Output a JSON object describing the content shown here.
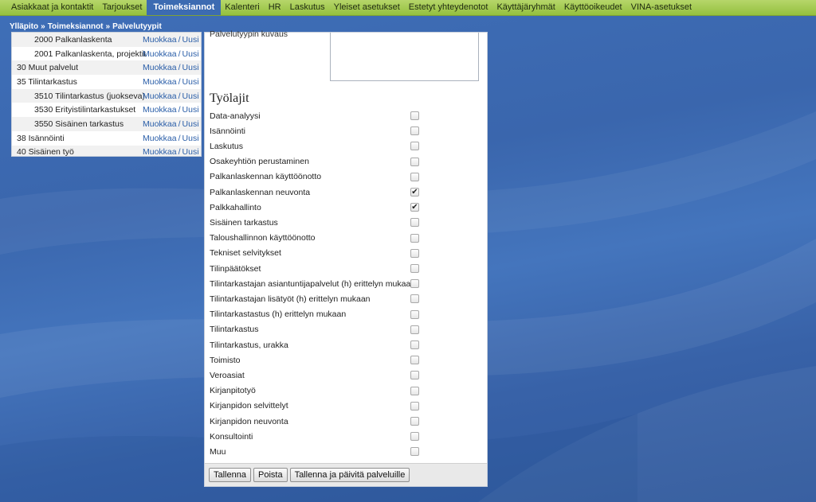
{
  "nav": {
    "items": [
      {
        "label": "Asiakkaat ja kontaktit",
        "active": false
      },
      {
        "label": "Tarjoukset",
        "active": false
      },
      {
        "label": "Toimeksiannot",
        "active": true
      },
      {
        "label": "Kalenteri",
        "active": false
      },
      {
        "label": "HR",
        "active": false
      },
      {
        "label": "Laskutus",
        "active": false
      },
      {
        "label": "Yleiset asetukset",
        "active": false
      },
      {
        "label": "Estetyt yhteydenotot",
        "active": false
      },
      {
        "label": "Käyttäjäryhmät",
        "active": false
      },
      {
        "label": "Käyttöoikeudet",
        "active": false
      },
      {
        "label": "VINA-asetukset",
        "active": false
      }
    ]
  },
  "breadcrumb": {
    "items": [
      "Ylläpito",
      "Toimeksiannot",
      "Palvelutyypit"
    ],
    "separator": "»"
  },
  "service_list": {
    "edit_label": "Muokkaa",
    "new_label": "Uusi",
    "separator": "/",
    "rows": [
      {
        "name": "2000 Palkanlaskenta",
        "level": 1
      },
      {
        "name": "2001 Palkanlaskenta, projektit",
        "level": 1
      },
      {
        "name": "30 Muut palvelut",
        "level": 0
      },
      {
        "name": "35 Tilintarkastus",
        "level": 0
      },
      {
        "name": "3510 Tilintarkastus (juokseva)",
        "level": 1
      },
      {
        "name": "3530 Erityistilintarkastukset",
        "level": 1
      },
      {
        "name": "3550 Sisäinen tarkastus",
        "level": 1
      },
      {
        "name": "38 Isännöinti",
        "level": 0
      },
      {
        "name": "40 Sisäinen työ",
        "level": 0
      }
    ]
  },
  "form": {
    "description_label": "Palvelutyypin kuvaus",
    "description_value": "",
    "worktypes_title": "Työlajit",
    "worktypes": [
      {
        "label": "Data-analyysi",
        "checked": false
      },
      {
        "label": "Isännöinti",
        "checked": false
      },
      {
        "label": "Laskutus",
        "checked": false
      },
      {
        "label": "Osakeyhtiön perustaminen",
        "checked": false
      },
      {
        "label": "Palkanlaskennan käyttöönotto",
        "checked": false
      },
      {
        "label": "Palkanlaskennan neuvonta",
        "checked": true
      },
      {
        "label": "Palkkahallinto",
        "checked": true
      },
      {
        "label": "Sisäinen tarkastus",
        "checked": false
      },
      {
        "label": "Taloushallinnon käyttöönotto",
        "checked": false
      },
      {
        "label": "Tekniset selvitykset",
        "checked": false
      },
      {
        "label": "Tilinpäätökset",
        "checked": false
      },
      {
        "label": "Tilintarkastajan asiantuntijapalvelut (h) erittelyn mukaan",
        "checked": false
      },
      {
        "label": "Tilintarkastajan lisätyöt (h) erittelyn mukaan",
        "checked": false
      },
      {
        "label": "Tilintarkastastus (h) erittelyn mukaan",
        "checked": false
      },
      {
        "label": "Tilintarkastus",
        "checked": false
      },
      {
        "label": "Tilintarkastus, urakka",
        "checked": false
      },
      {
        "label": "Toimisto",
        "checked": false
      },
      {
        "label": "Veroasiat",
        "checked": false
      },
      {
        "label": "Kirjanpitotyö",
        "checked": false
      },
      {
        "label": "Kirjanpidon selvittelyt",
        "checked": false
      },
      {
        "label": "Kirjanpidon neuvonta",
        "checked": false
      },
      {
        "label": "Konsultointi",
        "checked": false
      },
      {
        "label": "Muu",
        "checked": false
      }
    ],
    "buttons": {
      "save": "Tallenna",
      "delete": "Poista",
      "save_update": "Tallenna ja päivitä palveluille"
    }
  },
  "colors": {
    "nav_green": "#94c03e",
    "nav_active": "#3c6bb2",
    "background_blue": "#3a66ad",
    "link_blue": "#2a5ea8"
  }
}
